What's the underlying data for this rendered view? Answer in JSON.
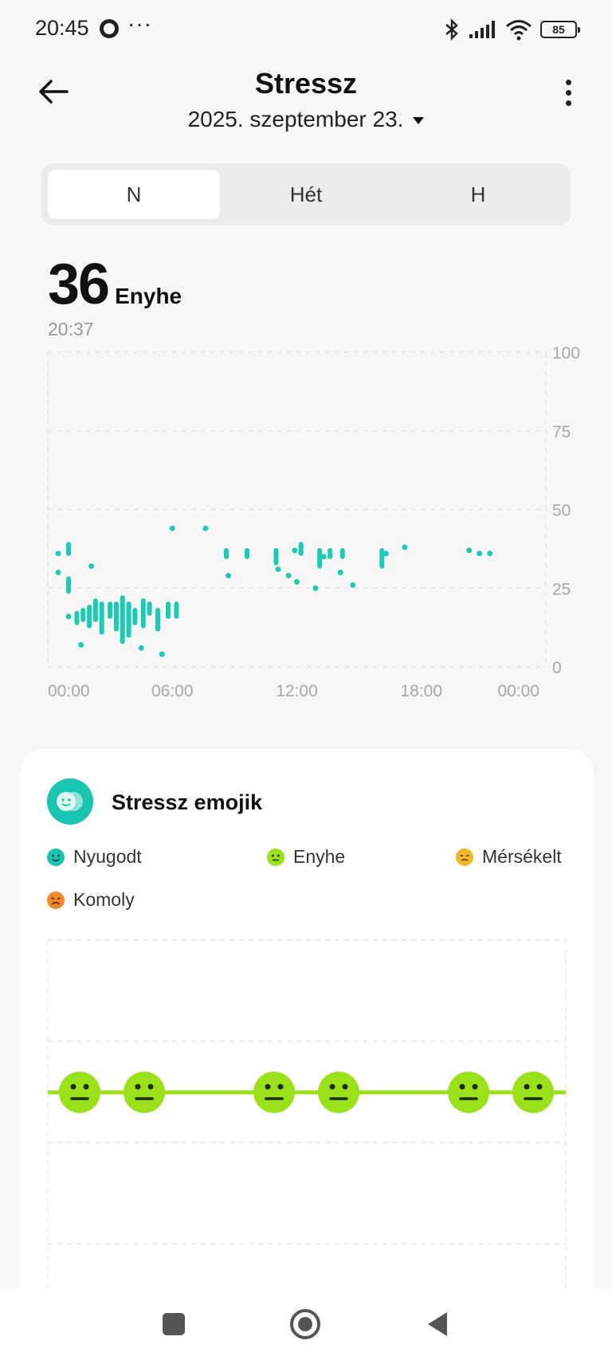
{
  "status_bar": {
    "time": "20:45",
    "battery": "85"
  },
  "header": {
    "title": "Stressz",
    "date": "2025. szeptember 23."
  },
  "tabs": [
    {
      "label": "N",
      "active": true
    },
    {
      "label": "Hét",
      "active": false
    },
    {
      "label": "H",
      "active": false
    }
  ],
  "current": {
    "value": "36",
    "level": "Enyhe",
    "time": "20:37"
  },
  "chart_data": {
    "type": "scatter",
    "x_ticks": [
      "00:00",
      "06:00",
      "12:00",
      "18:00",
      "00:00"
    ],
    "y_ticks": [
      "100",
      "75",
      "50",
      "25",
      "0"
    ],
    "xlim": [
      0,
      24
    ],
    "ylim": [
      0,
      100
    ],
    "color": "#1ccbb4",
    "dots": [
      [
        0.5,
        36
      ],
      [
        0.5,
        30
      ],
      [
        1.0,
        16
      ],
      [
        1.6,
        7
      ],
      [
        2.1,
        32
      ],
      [
        6.0,
        44
      ],
      [
        7.6,
        44
      ],
      [
        8.7,
        29
      ],
      [
        11.1,
        31
      ],
      [
        11.6,
        29
      ],
      [
        12.0,
        27
      ],
      [
        12.9,
        25
      ],
      [
        14.1,
        30
      ],
      [
        14.7,
        26
      ],
      [
        17.2,
        38
      ],
      [
        20.3,
        37
      ],
      [
        20.8,
        36
      ],
      [
        21.3,
        36
      ],
      [
        4.5,
        6
      ],
      [
        5.5,
        4
      ],
      [
        11.9,
        37
      ],
      [
        13.3,
        35
      ],
      [
        16.3,
        36
      ]
    ],
    "bars": [
      [
        1.0,
        24,
        28
      ],
      [
        1.0,
        36,
        39
      ],
      [
        1.4,
        14,
        17
      ],
      [
        1.7,
        15,
        18
      ],
      [
        2.0,
        13,
        19
      ],
      [
        2.3,
        15,
        21
      ],
      [
        2.6,
        11,
        20
      ],
      [
        3.0,
        16,
        20
      ],
      [
        3.3,
        12,
        20
      ],
      [
        3.6,
        8,
        22
      ],
      [
        3.9,
        10,
        20
      ],
      [
        4.2,
        14,
        18
      ],
      [
        4.6,
        13,
        21
      ],
      [
        4.9,
        17,
        20
      ],
      [
        5.3,
        12,
        18
      ],
      [
        5.8,
        16,
        20
      ],
      [
        6.2,
        16,
        20
      ],
      [
        8.6,
        35,
        37
      ],
      [
        9.6,
        35,
        37
      ],
      [
        11.0,
        33,
        37
      ],
      [
        12.2,
        36,
        39
      ],
      [
        13.1,
        32,
        37
      ],
      [
        13.6,
        35,
        37
      ],
      [
        14.2,
        35,
        37
      ],
      [
        16.1,
        32,
        37
      ]
    ]
  },
  "emoji_card": {
    "title": "Stressz emojik",
    "legend": [
      {
        "label": "Nyugodt",
        "color": "#19c4b0"
      },
      {
        "label": "Enyhe",
        "color": "#9be11a"
      },
      {
        "label": "Mérsékelt",
        "color": "#f4b728"
      },
      {
        "label": "Komoly",
        "color": "#f08a24"
      }
    ],
    "emoji_points": 6
  }
}
